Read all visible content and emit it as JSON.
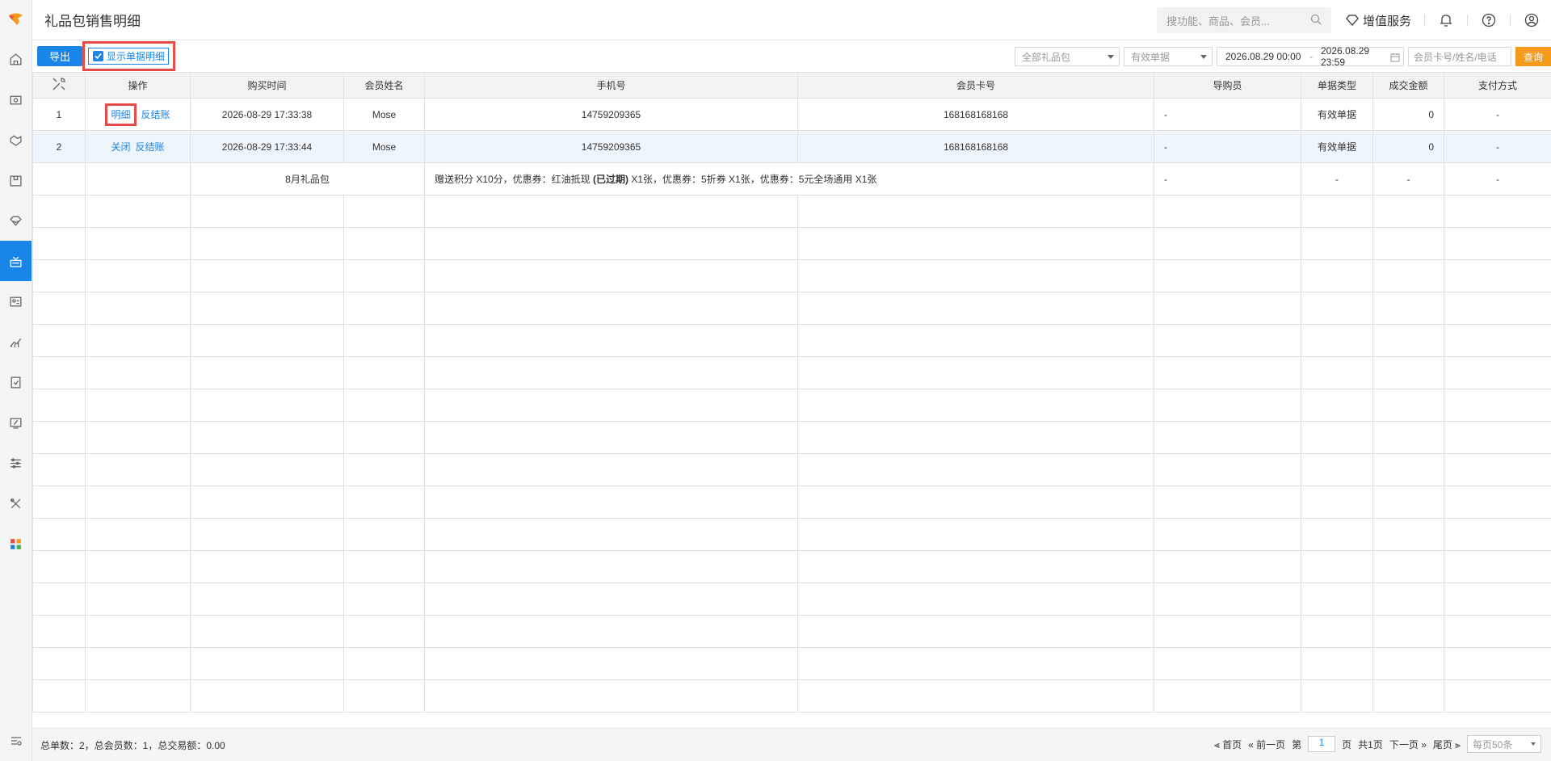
{
  "header": {
    "title": "礼品包销售明细",
    "search_placeholder": "搜功能、商品、会员...",
    "vip_label": "增值服务"
  },
  "toolbar": {
    "export_label": "导出",
    "show_detail_label": "显示单据明细",
    "giftpack_select": "全部礼品包",
    "doc_select": "有效单据",
    "date_start": "2026.08.29 00:00",
    "date_sep": "-",
    "date_end": "2026.08.29 23:59",
    "member_placeholder": "会员卡号/姓名/电话",
    "query_label": "查询"
  },
  "table": {
    "headers": [
      "操作",
      "购买时间",
      "会员姓名",
      "手机号",
      "会员卡号",
      "导购员",
      "单据类型",
      "成交金额",
      "支付方式"
    ],
    "rows": [
      {
        "idx": "1",
        "act1": "明细",
        "act2": "反结账",
        "time": "2026-08-29 17:33:38",
        "name": "Mose",
        "phone": "14759209365",
        "card": "168168168168",
        "guide": "-",
        "type": "有效单据",
        "amount": "0",
        "pay": "-"
      },
      {
        "idx": "2",
        "act1": "关闭",
        "act2": "反结账",
        "time": "2026-08-29 17:33:44",
        "name": "Mose",
        "phone": "14759209365",
        "card": "168168168168",
        "guide": "-",
        "type": "有效单据",
        "amount": "0",
        "pay": "-"
      }
    ],
    "detail": {
      "pack": "8月礼品包",
      "content_pre": "赠送积分 X10分，优惠券：红油抵现 ",
      "content_bold": "(已过期)",
      "content_post": " X1张，优惠券：5折券 X1张，优惠券：5元全场通用 X1张",
      "guide": "-",
      "type": "-",
      "amount": "-",
      "pay": "-"
    }
  },
  "footer": {
    "summary": "总单数：2，总会员数：1，总交易额：0.00",
    "first": "首页",
    "prev": "前一页",
    "page_prefix": "第",
    "page_num": "1",
    "page_suffix": "页",
    "total": "共1页",
    "next": "下一页",
    "last": "尾页",
    "page_size": "每页50条"
  },
  "colors": {
    "accent": "#1a85e8",
    "query": "#f59a1b",
    "highlight": "#e84a4a"
  }
}
